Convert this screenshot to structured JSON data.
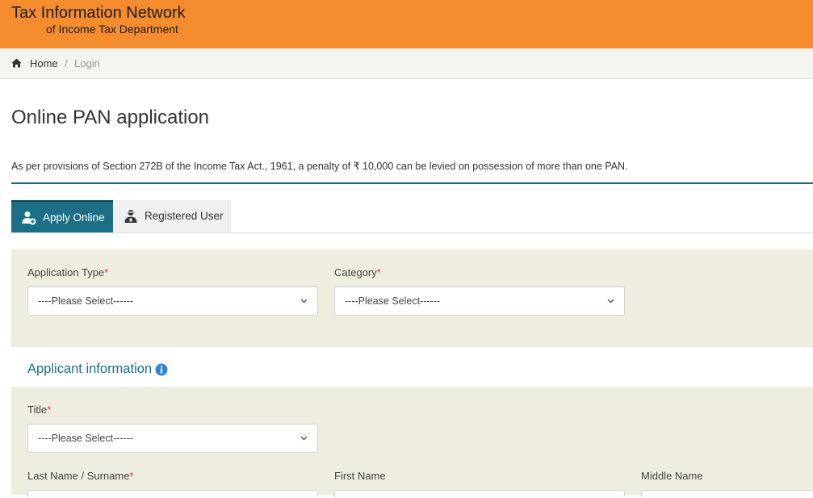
{
  "header": {
    "title": "Tax Information Network",
    "subtitle": "of Income Tax Department"
  },
  "breadcrumb": {
    "home": "Home",
    "separator": "/",
    "current": "Login"
  },
  "page": {
    "title": "Online PAN application",
    "notice": "As per provisions of Section 272B of the Income Tax Act., 1961, a penalty of ₹ 10,000 can be levied on possession of more than one PAN."
  },
  "tabs": [
    {
      "label": "Apply Online",
      "icon": "add-user-icon",
      "active": true
    },
    {
      "label": "Registered User",
      "icon": "user-icon",
      "active": false
    }
  ],
  "form": {
    "application_type": {
      "label": "Application Type",
      "required": "*",
      "value": "----Please Select------"
    },
    "category": {
      "label": "Category",
      "required": "*",
      "value": "----Please Select------"
    },
    "applicant_section_title": "Applicant information",
    "title_field": {
      "label": "Title",
      "required": "*",
      "value": "----Please Select------"
    },
    "last_name": {
      "label": "Last Name / Surname",
      "required": "*"
    },
    "first_name": {
      "label": "First Name"
    },
    "middle_name": {
      "label": "Middle Name"
    }
  },
  "colors": {
    "header": "#f58c2d",
    "accent": "#1c6f87",
    "panel": "#eeeddf",
    "required": "#e03030"
  }
}
